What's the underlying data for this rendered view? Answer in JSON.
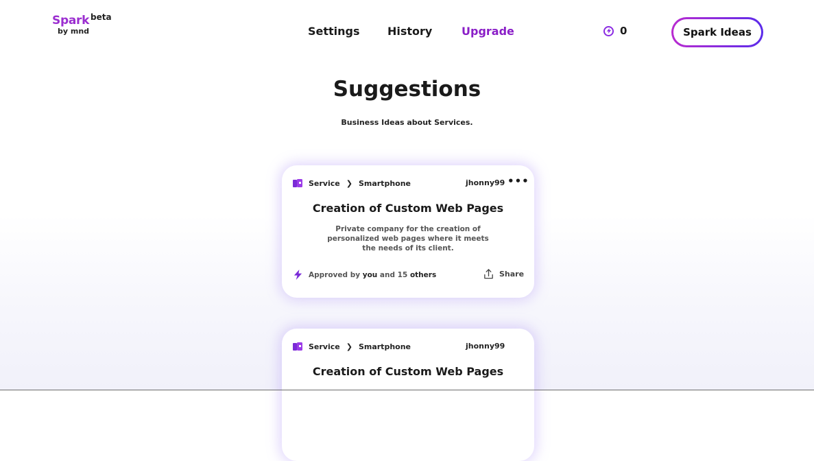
{
  "header": {
    "logo": {
      "brand": "Spark",
      "beta": "beta",
      "by": "by mnd"
    },
    "nav": [
      {
        "label": "Settings"
      },
      {
        "label": "History"
      },
      {
        "label": "Upgrade"
      }
    ],
    "credits": {
      "value": "0",
      "icon": "bolt-circle-icon"
    },
    "spark_button": "Spark Ideas"
  },
  "main": {
    "title": "Suggestions",
    "subtitle": "Business Ideas about Services."
  },
  "cards": [
    {
      "category": "Service",
      "subcategory": "Smartphone",
      "author": "jhonny99",
      "more": "•••",
      "title": "Creation of Custom Web Pages",
      "description": "Private company for the creation of personalized web pages where it meets the needs of its client.",
      "approved_prefix": "Approved by",
      "approved_you": "you",
      "approved_middle": "and 15",
      "approved_others": "others",
      "share": "Share"
    },
    {
      "category": "Service",
      "subcategory": "Smartphone",
      "author": "jhonny99",
      "title": "Creation of Custom Web Pages"
    }
  ],
  "colors": {
    "accent": "#8a1ec7",
    "brand": "#9b2ed0",
    "card_glow": "#a88cf5"
  }
}
